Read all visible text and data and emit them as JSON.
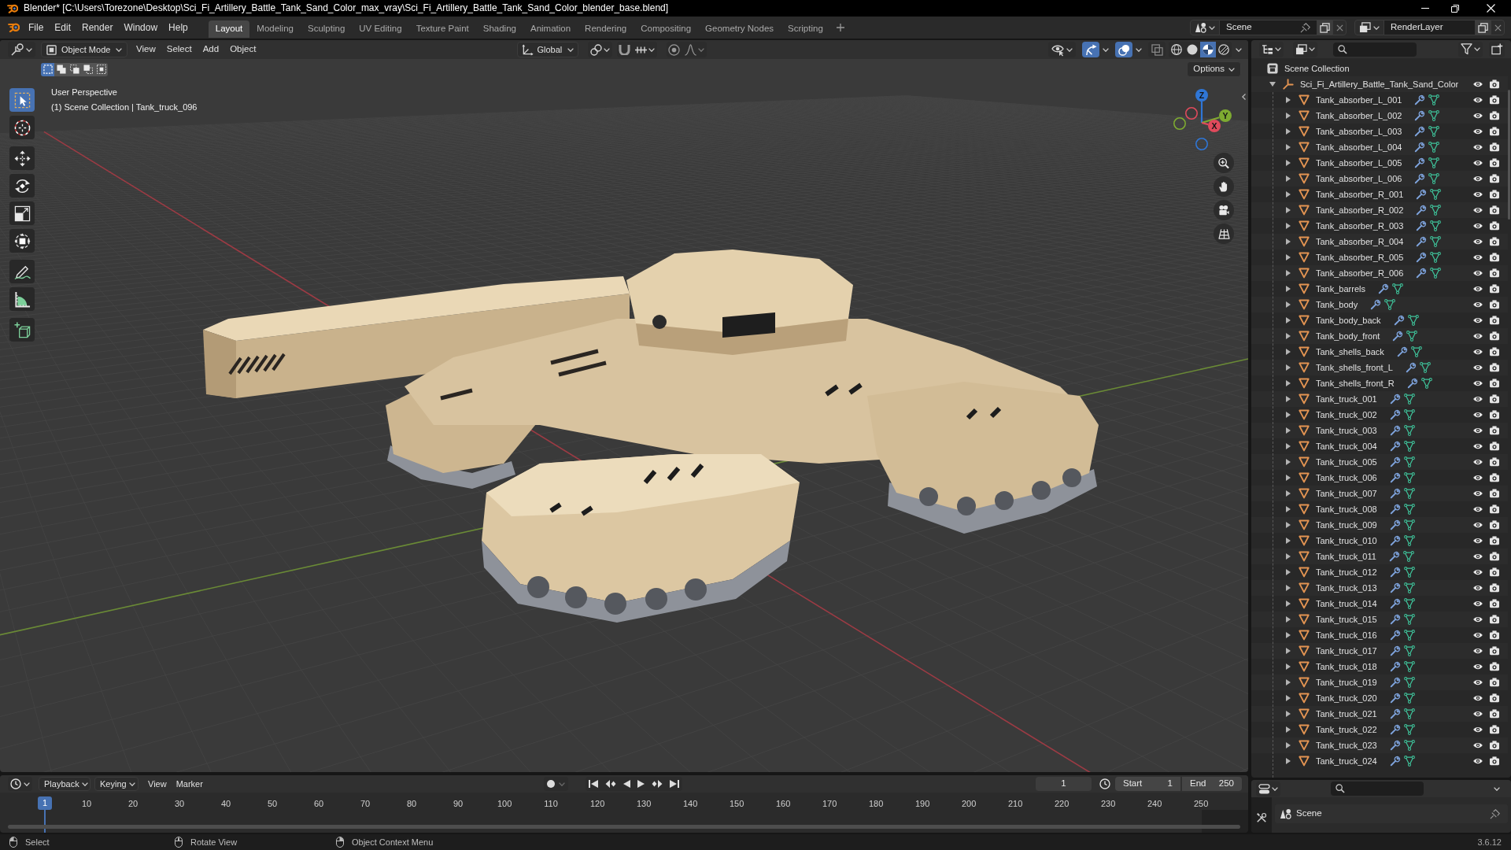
{
  "window": {
    "title": "Blender* [C:\\Users\\Torezone\\Desktop\\Sci_Fi_Artillery_Battle_Tank_Sand_Color_max_vray\\Sci_Fi_Artillery_Battle_Tank_Sand_Color_blender_base.blend]"
  },
  "menu": [
    "File",
    "Edit",
    "Render",
    "Window",
    "Help"
  ],
  "workspaces": [
    {
      "label": "Layout",
      "selected": true
    },
    {
      "label": "Modeling",
      "selected": false
    },
    {
      "label": "Sculpting",
      "selected": false
    },
    {
      "label": "UV Editing",
      "selected": false
    },
    {
      "label": "Texture Paint",
      "selected": false
    },
    {
      "label": "Shading",
      "selected": false
    },
    {
      "label": "Animation",
      "selected": false
    },
    {
      "label": "Rendering",
      "selected": false
    },
    {
      "label": "Compositing",
      "selected": false
    },
    {
      "label": "Geometry Nodes",
      "selected": false
    },
    {
      "label": "Scripting",
      "selected": false
    }
  ],
  "scene": {
    "value": "Scene"
  },
  "view_layer": {
    "value": "RenderLayer"
  },
  "viewport": {
    "mode": "Object Mode",
    "menus": [
      "View",
      "Select",
      "Add",
      "Object"
    ],
    "orientation": "Global",
    "snap_on": false,
    "proportional_on": false,
    "toggles": [
      {
        "kind": "gizmos",
        "on": true
      },
      {
        "kind": "overlays",
        "on": true
      },
      {
        "kind": "xray",
        "on": false
      }
    ],
    "shading": [
      {
        "kind": "wireframe",
        "selected": false
      },
      {
        "kind": "solid",
        "selected": false
      },
      {
        "kind": "material",
        "selected": true
      },
      {
        "kind": "rendered",
        "selected": false
      }
    ],
    "select_modes": [
      {
        "kind": "set",
        "selected": true
      },
      {
        "kind": "extend",
        "selected": false
      },
      {
        "kind": "subtract",
        "selected": false
      },
      {
        "kind": "invert",
        "selected": false
      },
      {
        "kind": "intersect",
        "selected": false
      }
    ],
    "options": "Options",
    "info": [
      "User Perspective",
      "(1) Scene Collection | Tank_truck_096"
    ],
    "tools": [
      {
        "kind": "select_box",
        "selected": true
      },
      {
        "kind": "cursor",
        "selected": false
      },
      {
        "kind": "move",
        "selected": false
      },
      {
        "kind": "rotate",
        "selected": false
      },
      {
        "kind": "scale",
        "selected": false
      },
      {
        "kind": "transform",
        "selected": false
      },
      {
        "kind": "annotate",
        "selected": false
      },
      {
        "kind": "measure",
        "selected": false
      },
      {
        "kind": "add_cube",
        "selected": false
      }
    ],
    "gizmo_axes": [
      {
        "kind": "z",
        "label": "Z"
      },
      {
        "kind": "y",
        "label": "Y"
      },
      {
        "kind": "x",
        "label": "X"
      }
    ]
  },
  "outliner": {
    "root": {
      "kind": "collection",
      "label": "Scene Collection",
      "children": [
        {
          "kind": "empty",
          "label": "Sci_Fi_Artillery_Battle_Tank_Sand_Color",
          "expanded": true,
          "visible": true,
          "renderable": true,
          "children": [
            {
              "kind": "mesh",
              "label": "Tank_absorber_L_001",
              "expanded": false,
              "visible": true,
              "renderable": true
            },
            {
              "kind": "mesh",
              "label": "Tank_absorber_L_002",
              "expanded": false,
              "visible": true,
              "renderable": true
            },
            {
              "kind": "mesh",
              "label": "Tank_absorber_L_003",
              "expanded": false,
              "visible": true,
              "renderable": true
            },
            {
              "kind": "mesh",
              "label": "Tank_absorber_L_004",
              "expanded": false,
              "visible": true,
              "renderable": true
            },
            {
              "kind": "mesh",
              "label": "Tank_absorber_L_005",
              "expanded": false,
              "visible": true,
              "renderable": true
            },
            {
              "kind": "mesh",
              "label": "Tank_absorber_L_006",
              "expanded": false,
              "visible": true,
              "renderable": true
            },
            {
              "kind": "mesh",
              "label": "Tank_absorber_R_001",
              "expanded": false,
              "visible": true,
              "renderable": true
            },
            {
              "kind": "mesh",
              "label": "Tank_absorber_R_002",
              "expanded": false,
              "visible": true,
              "renderable": true
            },
            {
              "kind": "mesh",
              "label": "Tank_absorber_R_003",
              "expanded": false,
              "visible": true,
              "renderable": true
            },
            {
              "kind": "mesh",
              "label": "Tank_absorber_R_004",
              "expanded": false,
              "visible": true,
              "renderable": true
            },
            {
              "kind": "mesh",
              "label": "Tank_absorber_R_005",
              "expanded": false,
              "visible": true,
              "renderable": true
            },
            {
              "kind": "mesh",
              "label": "Tank_absorber_R_006",
              "expanded": false,
              "visible": true,
              "renderable": true
            },
            {
              "kind": "mesh",
              "label": "Tank_barrels",
              "expanded": false,
              "visible": true,
              "renderable": true
            },
            {
              "kind": "mesh",
              "label": "Tank_body",
              "expanded": false,
              "visible": true,
              "renderable": true
            },
            {
              "kind": "mesh",
              "label": "Tank_body_back",
              "expanded": false,
              "visible": true,
              "renderable": true
            },
            {
              "kind": "mesh",
              "label": "Tank_body_front",
              "expanded": false,
              "visible": true,
              "renderable": true
            },
            {
              "kind": "mesh",
              "label": "Tank_shells_back",
              "expanded": false,
              "visible": true,
              "renderable": true
            },
            {
              "kind": "mesh",
              "label": "Tank_shells_front_L",
              "expanded": false,
              "visible": true,
              "renderable": true
            },
            {
              "kind": "mesh",
              "label": "Tank_shells_front_R",
              "expanded": false,
              "visible": true,
              "renderable": true
            },
            {
              "kind": "mesh",
              "label": "Tank_truck_001",
              "expanded": false,
              "visible": true,
              "renderable": true
            },
            {
              "kind": "mesh",
              "label": "Tank_truck_002",
              "expanded": false,
              "visible": true,
              "renderable": true
            },
            {
              "kind": "mesh",
              "label": "Tank_truck_003",
              "expanded": false,
              "visible": true,
              "renderable": true
            },
            {
              "kind": "mesh",
              "label": "Tank_truck_004",
              "expanded": false,
              "visible": true,
              "renderable": true
            },
            {
              "kind": "mesh",
              "label": "Tank_truck_005",
              "expanded": false,
              "visible": true,
              "renderable": true
            },
            {
              "kind": "mesh",
              "label": "Tank_truck_006",
              "expanded": false,
              "visible": true,
              "renderable": true
            },
            {
              "kind": "mesh",
              "label": "Tank_truck_007",
              "expanded": false,
              "visible": true,
              "renderable": true
            },
            {
              "kind": "mesh",
              "label": "Tank_truck_008",
              "expanded": false,
              "visible": true,
              "renderable": true
            },
            {
              "kind": "mesh",
              "label": "Tank_truck_009",
              "expanded": false,
              "visible": true,
              "renderable": true
            },
            {
              "kind": "mesh",
              "label": "Tank_truck_010",
              "expanded": false,
              "visible": true,
              "renderable": true
            },
            {
              "kind": "mesh",
              "label": "Tank_truck_011",
              "expanded": false,
              "visible": true,
              "renderable": true
            },
            {
              "kind": "mesh",
              "label": "Tank_truck_012",
              "expanded": false,
              "visible": true,
              "renderable": true
            },
            {
              "kind": "mesh",
              "label": "Tank_truck_013",
              "expanded": false,
              "visible": true,
              "renderable": true
            },
            {
              "kind": "mesh",
              "label": "Tank_truck_014",
              "expanded": false,
              "visible": true,
              "renderable": true
            },
            {
              "kind": "mesh",
              "label": "Tank_truck_015",
              "expanded": false,
              "visible": true,
              "renderable": true
            },
            {
              "kind": "mesh",
              "label": "Tank_truck_016",
              "expanded": false,
              "visible": true,
              "renderable": true
            },
            {
              "kind": "mesh",
              "label": "Tank_truck_017",
              "expanded": false,
              "visible": true,
              "renderable": true
            },
            {
              "kind": "mesh",
              "label": "Tank_truck_018",
              "expanded": false,
              "visible": true,
              "renderable": true
            },
            {
              "kind": "mesh",
              "label": "Tank_truck_019",
              "expanded": false,
              "visible": true,
              "renderable": true
            },
            {
              "kind": "mesh",
              "label": "Tank_truck_020",
              "expanded": false,
              "visible": true,
              "renderable": true
            },
            {
              "kind": "mesh",
              "label": "Tank_truck_021",
              "expanded": false,
              "visible": true,
              "renderable": true
            },
            {
              "kind": "mesh",
              "label": "Tank_truck_022",
              "expanded": false,
              "visible": true,
              "renderable": true
            },
            {
              "kind": "mesh",
              "label": "Tank_truck_023",
              "expanded": false,
              "visible": true,
              "renderable": true
            },
            {
              "kind": "mesh",
              "label": "Tank_truck_024",
              "expanded": false,
              "visible": true,
              "renderable": true
            }
          ]
        }
      ]
    }
  },
  "properties": {
    "context": "Scene"
  },
  "timeline": {
    "menus": [
      "Playback",
      "Keying",
      "View",
      "Marker"
    ],
    "current_frame": "1",
    "start": {
      "label": "Start",
      "value": "1"
    },
    "end": {
      "label": "End",
      "value": "250"
    },
    "playhead": "1",
    "ruler": [
      "10",
      "20",
      "30",
      "40",
      "50",
      "60",
      "70",
      "80",
      "90",
      "100",
      "110",
      "120",
      "130",
      "140",
      "150",
      "160",
      "170",
      "180",
      "190",
      "200",
      "210",
      "220",
      "230",
      "240",
      "250"
    ]
  },
  "status_bar": {
    "hints": [
      "Select",
      "Rotate View",
      "Object Context Menu"
    ],
    "version": "3.6.12"
  }
}
